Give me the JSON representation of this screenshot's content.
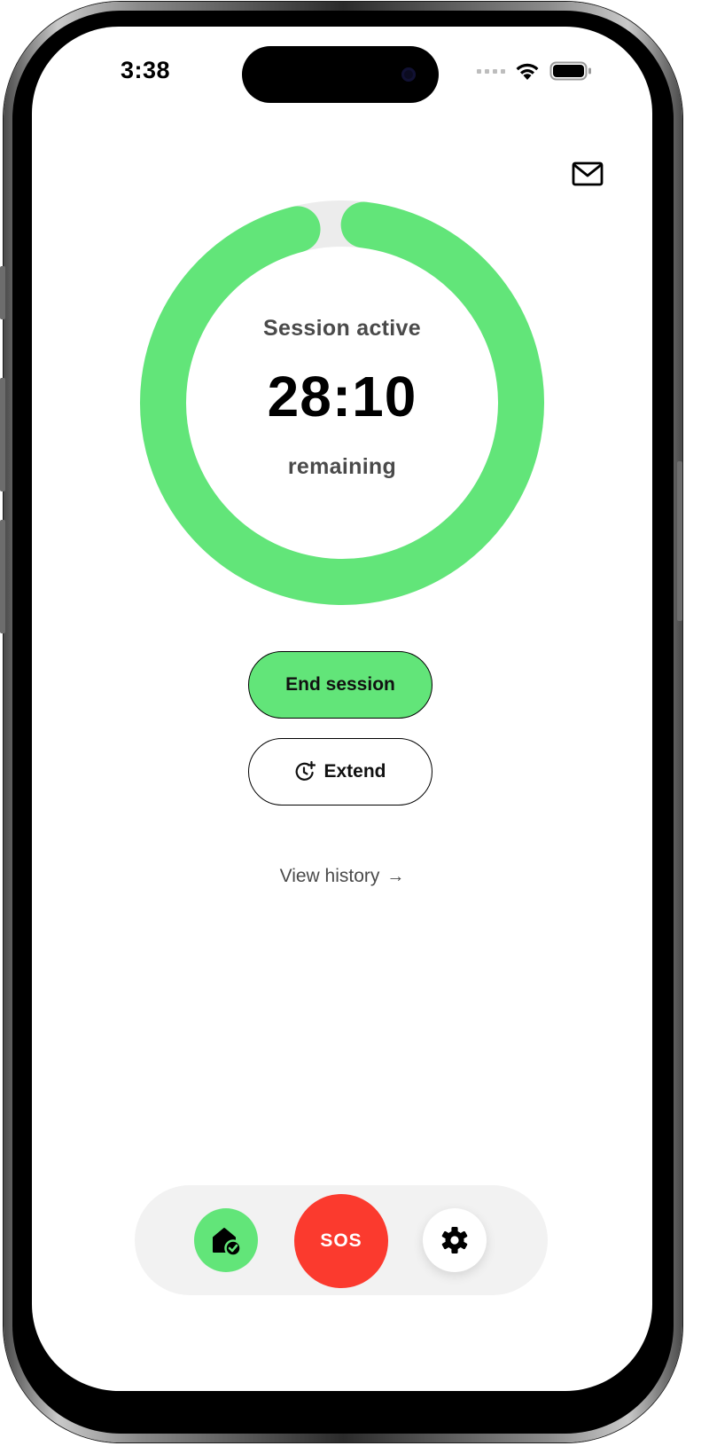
{
  "status_bar": {
    "time": "3:38"
  },
  "header": {
    "mail_icon": "envelope-icon"
  },
  "session": {
    "status_label": "Session active",
    "time_remaining": "28:10",
    "remaining_label": "remaining",
    "progress_fraction": 0.94
  },
  "actions": {
    "end_label": "End session",
    "extend_label": "Extend",
    "extend_icon": "clock-plus-icon",
    "history_label": "View history",
    "history_arrow": "→"
  },
  "bottom_nav": {
    "home_icon": "house-check-icon",
    "sos_label": "SOS",
    "settings_icon": "gear-icon"
  },
  "colors": {
    "accent_green": "#62e579",
    "ring_track": "#ececec",
    "sos_red": "#fb3a2e",
    "text_dark": "#000000",
    "text_muted": "#4a4a4a"
  }
}
